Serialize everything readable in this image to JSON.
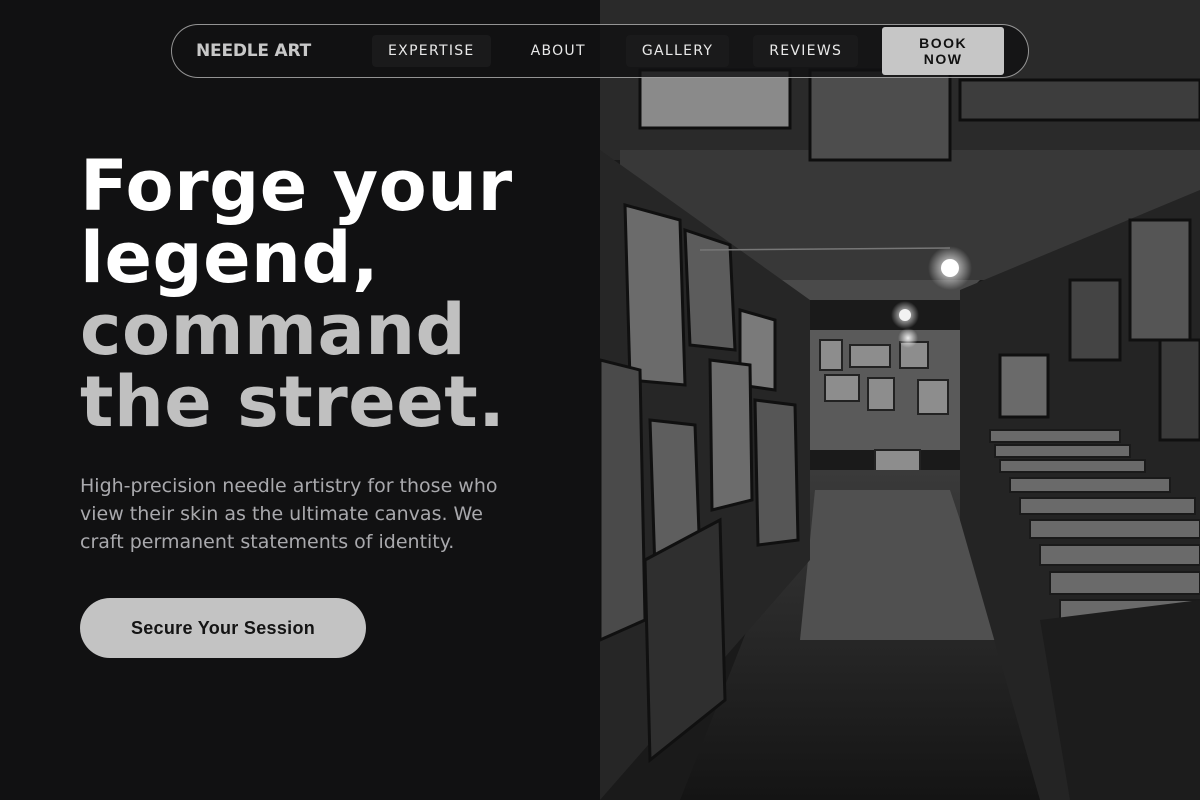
{
  "nav": {
    "logo": "NEEDLE ART",
    "links": [
      {
        "label": "EXPERTISE"
      },
      {
        "label": "ABOUT"
      },
      {
        "label": "GALLERY"
      },
      {
        "label": "REVIEWS"
      }
    ],
    "book_label": "BOOK NOW"
  },
  "hero": {
    "headline_lines": [
      "Forge your",
      "legend,",
      "command",
      "the street."
    ],
    "subtitle": "High-precision needle artistry for those who view their skin as the ultimate canvas. We craft permanent statements of identity.",
    "cta_label": "Secure Your Session"
  },
  "colors": {
    "background": "#111112",
    "headline_primary": "#ffffff",
    "headline_secondary": "#c0c0c0",
    "button": "#c3c3c3"
  },
  "image": {
    "description_icon": "photo-gallery-corridor"
  }
}
